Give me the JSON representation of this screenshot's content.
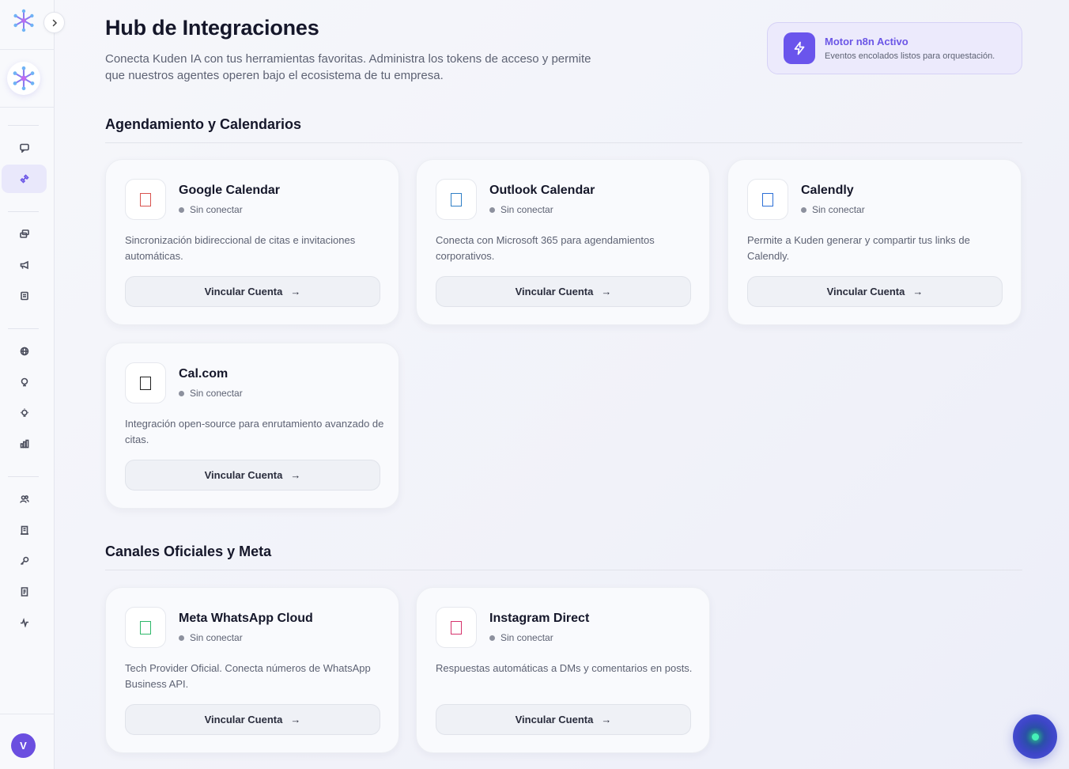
{
  "header": {
    "title": "Hub de Integraciones",
    "subtitle": "Conecta Kuden IA con tus herramientas favoritas. Administra los tokens de acceso y permite que nuestros agentes operen bajo el ecosistema de tu empresa."
  },
  "engine": {
    "title": "Motor n8n Activo",
    "subtitle": "Eventos encolados listos para orquestación."
  },
  "user": {
    "initial": "V"
  },
  "sections": [
    {
      "title": "Agendamiento y Calendarios",
      "cards": [
        {
          "name": "Google Calendar",
          "status": "Sin conectar",
          "description": "Sincronización bidireccional de citas e invitaciones automáticas.",
          "button": "Vincular Cuenta",
          "icon": "google-calendar-icon",
          "icon_color": "#d9534f"
        },
        {
          "name": "Outlook Calendar",
          "status": "Sin conectar",
          "description": "Conecta con Microsoft 365 para agendamientos corporativos.",
          "button": "Vincular Cuenta",
          "icon": "outlook-calendar-icon",
          "icon_color": "#2f7fc6"
        },
        {
          "name": "Calendly",
          "status": "Sin conectar",
          "description": "Permite a Kuden generar y compartir tus links de Calendly.",
          "button": "Vincular Cuenta",
          "icon": "calendly-icon",
          "icon_color": "#2c6fd6"
        },
        {
          "name": "Cal.com",
          "status": "Sin conectar",
          "description": "Integración open-source para enrutamiento avanzado de citas.",
          "button": "Vincular Cuenta",
          "icon": "calcom-icon",
          "icon_color": "#222222"
        }
      ]
    },
    {
      "title": "Canales Oficiales y Meta",
      "cards": [
        {
          "name": "Meta WhatsApp Cloud",
          "status": "Sin conectar",
          "description": "Tech Provider Oficial. Conecta números de WhatsApp Business API.",
          "button": "Vincular Cuenta",
          "icon": "whatsapp-icon",
          "icon_color": "#2fb86a"
        },
        {
          "name": "Instagram Direct",
          "status": "Sin conectar",
          "description": "Respuestas automáticas a DMs y comentarios en posts.",
          "button": "Vincular Cuenta",
          "icon": "instagram-icon",
          "icon_color": "#d6336c"
        }
      ]
    }
  ],
  "colors": {
    "accent": "#6b56e6",
    "status_dot": "#8d919e"
  }
}
